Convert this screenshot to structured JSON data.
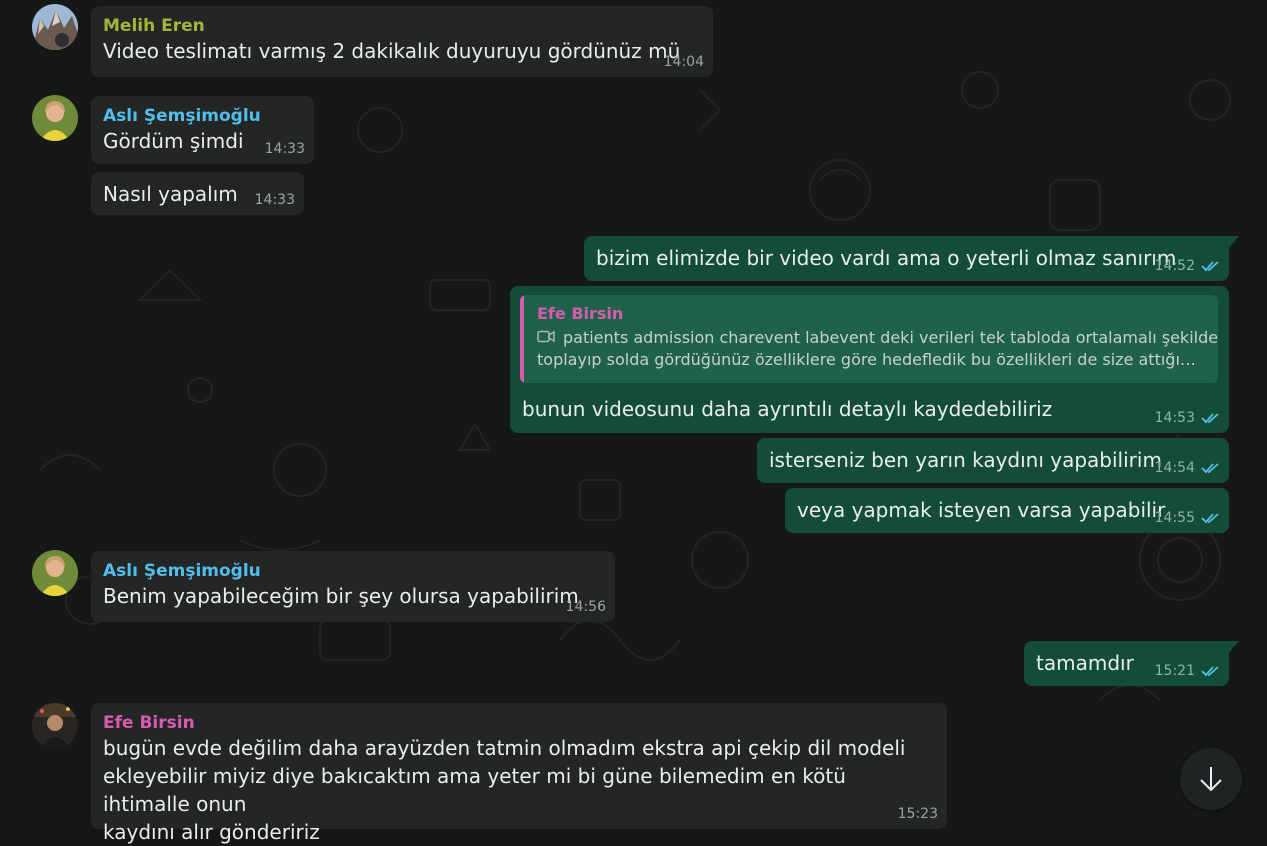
{
  "colors": {
    "background": "#161717",
    "incoming_bubble": "#242626",
    "outgoing_bubble": "#144d37",
    "read_ticks": "#53bdeb",
    "sender_melih": "#a5b337",
    "sender_asli": "#53bdeb",
    "sender_efe": "#d65cb0"
  },
  "messages": [
    {
      "sender": "Melih Eren",
      "text": "Video teslimatı varmış 2 dakikalık duyuruyu gördünüz mü",
      "time": "14:04"
    },
    {
      "sender": "Aslı Şemşimoğlu",
      "text": "Gördüm şimdi",
      "time": "14:33"
    },
    {
      "text": "Nasıl yapalım",
      "time": "14:33"
    },
    {
      "text": "bizim elimizde bir video vardı ama o yeterli olmaz sanırım",
      "time": "14:52",
      "status": "read"
    },
    {
      "quote": {
        "sender": "Efe Birsin",
        "icon": "video-camera-icon",
        "text_line1": "patients admission charevent labevent deki verileri tek tabloda ortalamalı şekilde",
        "text_line2": "toplayıp solda gördüğünüz özelliklere göre hedefledik bu özellikleri de size attığı…"
      },
      "text": "bunun videosunu daha ayrıntılı detaylı kaydedebiliriz",
      "time": "14:53",
      "status": "read"
    },
    {
      "text": "isterseniz ben yarın kaydını yapabilirim",
      "time": "14:54",
      "status": "read"
    },
    {
      "text": "veya yapmak isteyen varsa yapabilir",
      "time": "14:55",
      "status": "read"
    },
    {
      "sender": "Aslı Şemşimoğlu",
      "text": "Benim yapabileceğim bir şey olursa yapabilirim",
      "time": "14:56"
    },
    {
      "text": "tamamdır",
      "time": "15:21",
      "status": "read"
    },
    {
      "sender": "Efe Birsin",
      "text_line1": "bugün evde değilim daha arayüzden tatmin olmadım ekstra api çekip dil modeli",
      "text_line2": "ekleyebilir miyiz diye bakıcaktım ama yeter mi bi güne bilemedim en kötü ihtimalle onun",
      "text_line3": "kaydını alır göndeririz",
      "time": "15:23"
    }
  ],
  "scroll_button": {
    "icon": "arrow-down-icon"
  }
}
